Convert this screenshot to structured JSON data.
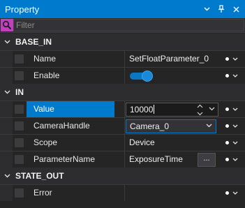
{
  "window": {
    "title": "Property"
  },
  "search": {
    "placeholder": "Filter",
    "value": ""
  },
  "sections": [
    {
      "label": "BASE_IN",
      "rows": [
        {
          "name": "Name",
          "value": "SetFloatParameter_0",
          "kind": "text"
        },
        {
          "name": "Enable",
          "value": "on",
          "kind": "toggle"
        }
      ]
    },
    {
      "label": "IN",
      "rows": [
        {
          "name": "Value",
          "value": "10000",
          "kind": "number",
          "selected": true
        },
        {
          "name": "CameraHandle",
          "value": "Camera_0",
          "kind": "combo"
        },
        {
          "name": "Scope",
          "value": "Device",
          "kind": "text"
        },
        {
          "name": "ParameterName",
          "value": "ExposureTime",
          "kind": "browse",
          "button": "..."
        }
      ]
    },
    {
      "label": "STATE_OUT",
      "rows": [
        {
          "name": "Error",
          "value": "",
          "kind": "text"
        }
      ]
    }
  ],
  "icons": {
    "window_menu": "chevron-down-icon",
    "pin": "pin-icon",
    "close": "close-icon",
    "search": "search-icon",
    "section_toggle": "chevron-down-icon",
    "row_binding": "dot-icon",
    "row_menu": "chevron-down-icon"
  },
  "colors": {
    "accent": "#007acc",
    "background": "#252526",
    "header": "#2d2d30"
  }
}
